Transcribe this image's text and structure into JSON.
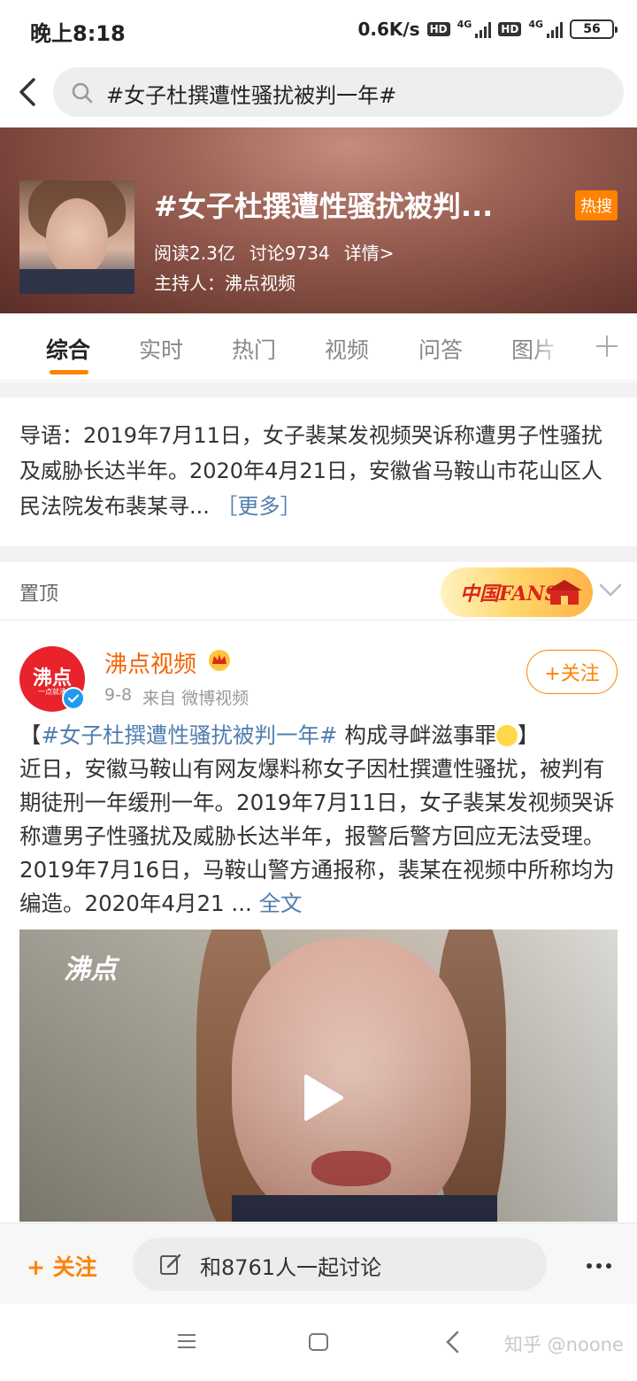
{
  "status_bar": {
    "time": "晚上8:18",
    "speed": "0.6K/s",
    "hd1": "HD",
    "net1": "4G",
    "hd2": "HD",
    "net2": "4G",
    "battery": "56"
  },
  "search": {
    "query": "#女子杜撰遭性骚扰被判一年#"
  },
  "topic": {
    "title": "#女子杜撰遭性骚扰被判...",
    "hot_badge": "热搜",
    "reads": "阅读2.3亿",
    "discussions": "讨论9734",
    "details": "详情>",
    "host": "主持人：沸点视频"
  },
  "tabs": [
    "综合",
    "实时",
    "热门",
    "视频",
    "问答",
    "图片"
  ],
  "intro": {
    "text": "导语：2019年7月11日，女子裴某发视频哭诉称遭男子性骚扰及威胁长达半年。2020年4月21日，安徽省马鞍山市花山区人民法院发布裴某寻...",
    "more": "［更多］"
  },
  "pinned": {
    "label": "置顶",
    "fans_badge": "中国FANS"
  },
  "post": {
    "avatar_text": "沸点",
    "avatar_sub": "一点就沸",
    "author": "沸点视频",
    "date": "9-8",
    "source": "来自 微博视频",
    "follow_label": "+关注",
    "open_bracket": "【",
    "topic_link": "#女子杜撰遭性骚扰被判一年#",
    "headline": " 构成寻衅滋事罪",
    "close_bracket": "】",
    "body": "近日，安徽马鞍山有网友爆料称女子因杜撰遭性骚扰，被判有期徒刑一年缓刑一年。2019年7月11日，女子裴某发视频哭诉称遭男子性骚扰及威胁长达半年，报警后警方回应无法受理。2019年7月16日，马鞍山警方通报称，裴某在视频中所称均为编造。2020年4月21 ...",
    "full_text": "全文",
    "video_logo": "沸点"
  },
  "bottom_bar": {
    "follow": "+ 关注",
    "discuss": "和8761人一起讨论"
  },
  "watermark": "知乎 @noone",
  "colors": {
    "accent": "#ff8200",
    "link": "#507daf",
    "author": "#f56200",
    "avatar_red": "#e8232c",
    "verified_blue": "#1e9bf0"
  }
}
